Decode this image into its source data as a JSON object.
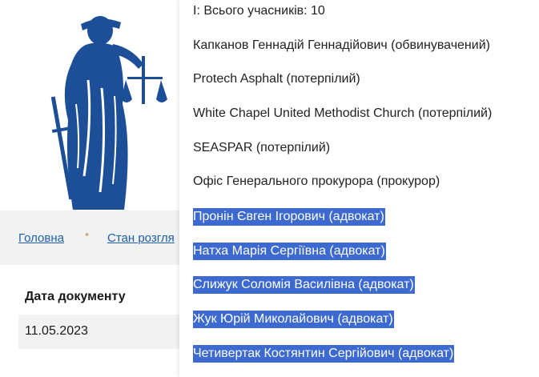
{
  "breadcrumb": {
    "home": "Головна",
    "separator": "•",
    "state": "Стан розгля"
  },
  "table": {
    "header": "Дата документу",
    "date": "11.05.2023"
  },
  "participants": {
    "title": "І: Всього учасників: 10",
    "items": [
      {
        "label": "Капканов Геннадій Геннадійович (обвинувачений)",
        "selected": false
      },
      {
        "label": "Protech Asphalt (потерпілий)",
        "selected": false
      },
      {
        "label": "White Chapel United Methodist Church (потерпілий)",
        "selected": false
      },
      {
        "label": "SEASPAR (потерпілий)",
        "selected": false
      },
      {
        "label": "Офіс Генерального прокурора (прокурор)",
        "selected": false
      },
      {
        "label": "Пронін Євген Ігорович (адвокат)",
        "selected": true
      },
      {
        "label": "Натха Марія Сергіївна (адвокат)",
        "selected": true
      },
      {
        "label": "Слижук Соломія Василівна (адвокат)",
        "selected": true
      },
      {
        "label": "Жук Юрій Миколайович (адвокат)",
        "selected": true
      },
      {
        "label": "Четивертак Костянтин Сергійович (адвокат)",
        "selected": true
      }
    ]
  },
  "colors": {
    "logo": "#1d4f98",
    "link": "#1f5fa8",
    "selection": "#3c6ad0",
    "breadcrumb_bg": "#f1f2f4"
  }
}
